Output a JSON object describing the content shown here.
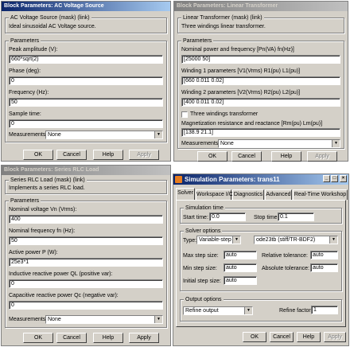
{
  "ac_source": {
    "title": "Block Parameters: AC Voltage Source",
    "group_title": "AC Voltage Source (mask) (link)",
    "description": "Ideal sinusoidal AC Voltage source.",
    "params_title": "Parameters",
    "fields": [
      {
        "label": "Peak amplitude (V):",
        "value": "660*sqrt(2)"
      },
      {
        "label": "Phase (deg):",
        "value": "0"
      },
      {
        "label": "Frequency (Hz):",
        "value": "50"
      },
      {
        "label": "Sample time:",
        "value": "0"
      }
    ],
    "measurements_label": "Measurements",
    "measurements_value": "None",
    "buttons": {
      "ok": "OK",
      "cancel": "Cancel",
      "help": "Help",
      "apply": "Apply"
    }
  },
  "transformer": {
    "title": "Block Parameters: Linear Transformer",
    "group_title": "Linear Transformer (mask) (link)",
    "description": "Three windings linear transformer.",
    "params_title": "Parameters",
    "fields": [
      {
        "label": "Nominal power and frequency [Pn(VA) fn(Hz)]",
        "value": "[25000 50]"
      },
      {
        "label": "Winding 1 parameters [V1(Vrms) R1(pu) L1(pu)]",
        "value": "[660 0.011 0.02]"
      },
      {
        "label": "Winding 2 parameters [V2(Vrms) R2(pu) L2(pu)]",
        "value": "[400 0.011 0.02]"
      }
    ],
    "three_windings_label": "Three windings transformer",
    "magnetization_label": "Magnetization resistance and reactance [Rm(pu) Lm(pu)]",
    "magnetization_value": "[138.9 21.1]",
    "measurements_label": "Measurements",
    "measurements_value": "None",
    "buttons": {
      "ok": "OK",
      "cancel": "Cancel",
      "help": "Help",
      "apply": "Apply"
    }
  },
  "rlc_load": {
    "title": "Block Parameters: Series RLC Load",
    "group_title": "Series RLC Load (mask) (link)",
    "description": "Implements a series RLC load.",
    "params_title": "Parameters",
    "fields": [
      {
        "label": "Nominal voltage Vn (Vrms):",
        "value": "400"
      },
      {
        "label": "Nominal frequency fn (Hz):",
        "value": "50"
      },
      {
        "label": "Active power P (W):",
        "value": "25e3*1"
      },
      {
        "label": "Inductive reactive power QL (positive var):",
        "value": "0"
      },
      {
        "label": "Capacitive reactive power Qc (negative var):",
        "value": "0"
      }
    ],
    "measurements_label": "Measurements",
    "measurements_value": "None",
    "buttons": {
      "ok": "OK",
      "cancel": "Cancel",
      "help": "Help",
      "apply": "Apply"
    }
  },
  "sim": {
    "title": "Simulation Parameters: trans11",
    "tabs": [
      "Solver",
      "Workspace I/O",
      "Diagnostics",
      "Advanced",
      "Real-Time Workshop"
    ],
    "sim_time_title": "Simulation time",
    "start_label": "Start time:",
    "start_value": "0.0",
    "stop_label": "Stop time:",
    "stop_value": "0.1",
    "solver_title": "Solver options",
    "type_label": "Type:",
    "type_value": "Variable-step",
    "solver_value": "ode23tb (stiff/TR-BDF2)",
    "max_step_label": "Max step size:",
    "max_step_value": "auto",
    "min_step_label": "Min step size:",
    "min_step_value": "auto",
    "init_step_label": "Initial step size:",
    "init_step_value": "auto",
    "rel_tol_label": "Relative tolerance:",
    "rel_tol_value": "auto",
    "abs_tol_label": "Absolute tolerance:",
    "abs_tol_value": "auto",
    "output_title": "Output options",
    "output_value": "Refine output",
    "refine_label": "Refine factor:",
    "refine_value": "1",
    "buttons": {
      "ok": "OK",
      "cancel": "Cancel",
      "help": "Help",
      "apply": "Apply"
    }
  }
}
